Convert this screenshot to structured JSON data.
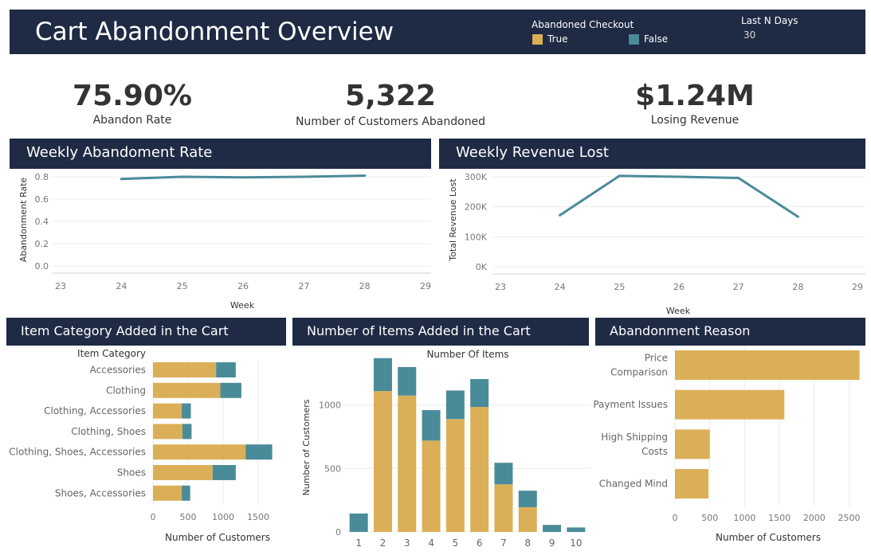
{
  "header": {
    "title": "Cart Abandonment Overview",
    "legend_title": "Abandoned Checkout",
    "legend": [
      {
        "label": "True",
        "color": "#dbaf57"
      },
      {
        "label": "False",
        "color": "#4a8b99"
      }
    ],
    "filter_label": "Last N Days",
    "filter_value": "30"
  },
  "kpis": [
    {
      "value": "75.90%",
      "label": "Abandon Rate"
    },
    {
      "value": "5,322",
      "label": "Number of Customers Abandoned"
    },
    {
      "value": "$1.24M",
      "label": "Losing Revenue"
    }
  ],
  "sections": {
    "weekly_rate": "Weekly Abandoment Rate",
    "weekly_revenue": "Weekly Revenue Lost",
    "item_category": "Item Category Added in the Cart",
    "items_added": "Number of Items Added in the Cart",
    "reason": "Abandonment Reason"
  },
  "colors": {
    "header_bg": "#1f2a44",
    "true": "#dbaf57",
    "false": "#4a8b99",
    "line": "#4a8b99"
  },
  "chart_data": [
    {
      "id": "weekly_rate",
      "type": "line",
      "x": [
        24,
        25,
        26,
        27,
        28
      ],
      "values": [
        0.78,
        0.8,
        0.795,
        0.8,
        0.81
      ],
      "xlabel": "Week",
      "ylabel": "Abandonment Rate",
      "xlim": [
        23,
        29
      ],
      "ylim": [
        0,
        0.8
      ],
      "xticks": [
        "23",
        "24",
        "25",
        "26",
        "27",
        "28",
        "29"
      ],
      "yticks": [
        "0.0",
        "0.2",
        "0.4",
        "0.6",
        "0.8"
      ],
      "ytick_values": [
        0,
        0.2,
        0.4,
        0.6,
        0.8
      ]
    },
    {
      "id": "weekly_revenue",
      "type": "line",
      "x": [
        24,
        25,
        26,
        27,
        28
      ],
      "values": [
        172000,
        303000,
        300000,
        296000,
        167000
      ],
      "xlabel": "Week",
      "ylabel": "Total Revenue Lost",
      "xlim": [
        23,
        29
      ],
      "ylim": [
        0,
        300000
      ],
      "xticks": [
        "23",
        "24",
        "25",
        "26",
        "27",
        "28",
        "29"
      ],
      "yticks": [
        "0K",
        "100K",
        "200K",
        "300K"
      ],
      "ytick_values": [
        0,
        100000,
        200000,
        300000
      ]
    },
    {
      "id": "item_category",
      "type": "bar",
      "orientation": "horizontal",
      "stacked": true,
      "categories_header": "Item Category",
      "categories": [
        "Accessories",
        "Clothing",
        "Clothing, Accessories",
        "Clothing, Shoes",
        "Clothing, Shoes, Accessories",
        "Shoes",
        "Shoes, Accessories"
      ],
      "series": [
        {
          "name": "True",
          "values": [
            900,
            960,
            410,
            420,
            1320,
            850,
            410
          ]
        },
        {
          "name": "False",
          "values": [
            280,
            300,
            130,
            130,
            380,
            330,
            120
          ]
        }
      ],
      "xlabel": "Number of Customers",
      "xlim": [
        0,
        1750
      ],
      "xticks": [
        "0",
        "500",
        "1000",
        "1500"
      ],
      "xtick_values": [
        0,
        500,
        1000,
        1500
      ]
    },
    {
      "id": "items_added",
      "type": "bar",
      "stacked": true,
      "title": "Number Of Items",
      "categories": [
        "1",
        "2",
        "3",
        "4",
        "5",
        "6",
        "7",
        "8",
        "9",
        "10"
      ],
      "series": [
        {
          "name": "True",
          "values": [
            0,
            1110,
            1075,
            720,
            890,
            985,
            375,
            195,
            0,
            0
          ]
        },
        {
          "name": "False",
          "values": [
            145,
            260,
            225,
            240,
            225,
            220,
            170,
            130,
            55,
            35
          ]
        }
      ],
      "ylabel": "Number of Customers",
      "ylim": [
        0,
        1400
      ],
      "yticks": [
        "0",
        "500",
        "1000"
      ],
      "ytick_values": [
        0,
        500,
        1000
      ]
    },
    {
      "id": "reason",
      "type": "bar",
      "orientation": "horizontal",
      "categories": [
        "Price Comparison",
        "Payment Issues",
        "High Shipping Costs",
        "Changed Mind"
      ],
      "series": [
        {
          "name": "True",
          "values": [
            2650,
            1570,
            500,
            480
          ]
        }
      ],
      "xlabel": "Number of Customers",
      "xlim": [
        0,
        2700
      ],
      "xticks": [
        "0",
        "500",
        "1000",
        "1500",
        "2000",
        "2500"
      ],
      "xtick_values": [
        0,
        500,
        1000,
        1500,
        2000,
        2500
      ]
    }
  ]
}
